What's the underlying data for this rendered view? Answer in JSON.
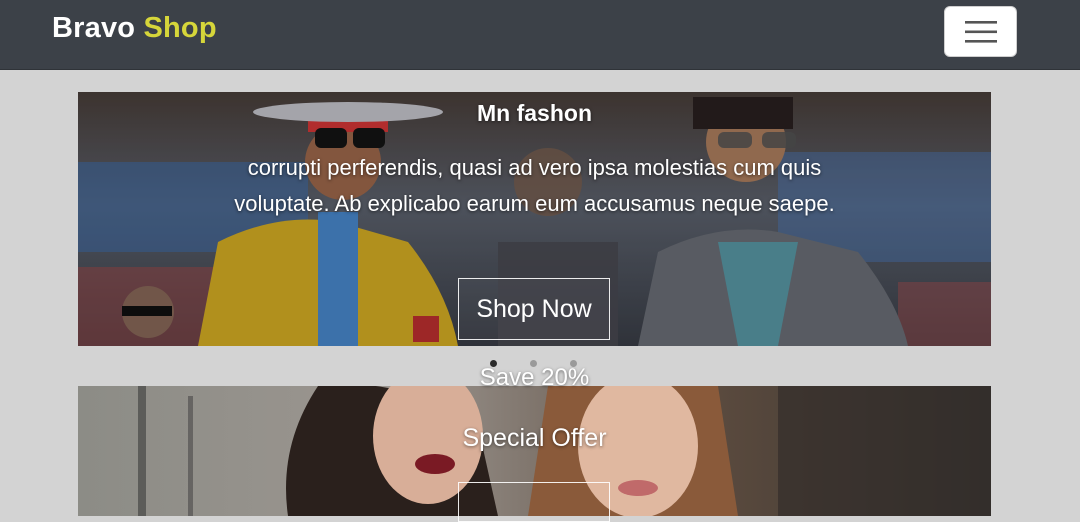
{
  "navbar": {
    "brand_first": "Bravo",
    "brand_accent": "Shop",
    "menu_icon": "hamburger-icon",
    "accent_color": "#d6d63a",
    "background": "#3c4148"
  },
  "carousel": {
    "slide": {
      "title": "Mn fashon",
      "text": "corrupti perferendis, quasi ad vero ipsa molestias cum quis voluptate. Ab explicabo earum eum accusamus neque saepe.",
      "button": "Shop Now"
    },
    "indicator_count": 3,
    "active_index": 0
  },
  "promo": {
    "save": "Save 20%",
    "offer": "Special Offer"
  }
}
